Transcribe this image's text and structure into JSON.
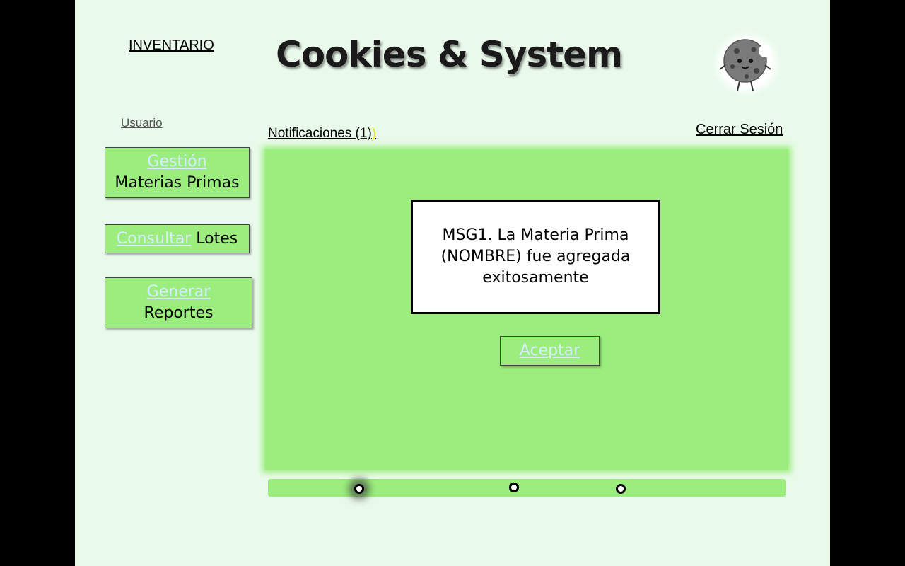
{
  "header": {
    "inventario_label": "INVENTARIO",
    "app_title": "Cookies & System",
    "logo_icon": "cookie-mascot-icon"
  },
  "user": {
    "usuario_label": "Usuario",
    "notifications_label": "Notificaciones (1)",
    "notifications_trailing": ")",
    "logout_label": "Cerrar Sesión"
  },
  "nav": {
    "gestion": {
      "link": "Gestión",
      "text": "Materias Primas"
    },
    "consultar": {
      "link": "Consultar",
      "text": "Lotes"
    },
    "generar": {
      "link": "Generar",
      "text": "Reportes"
    }
  },
  "dialog": {
    "message": "MSG1. La Materia Prima (NOMBRE) fue agregada exitosamente",
    "accept_label": "Aceptar"
  },
  "pager": {
    "dots": 3,
    "active_index": 0
  },
  "colors": {
    "background": "#e9faea",
    "accent_green": "#9bee7e",
    "link_light": "#d8ecff"
  }
}
